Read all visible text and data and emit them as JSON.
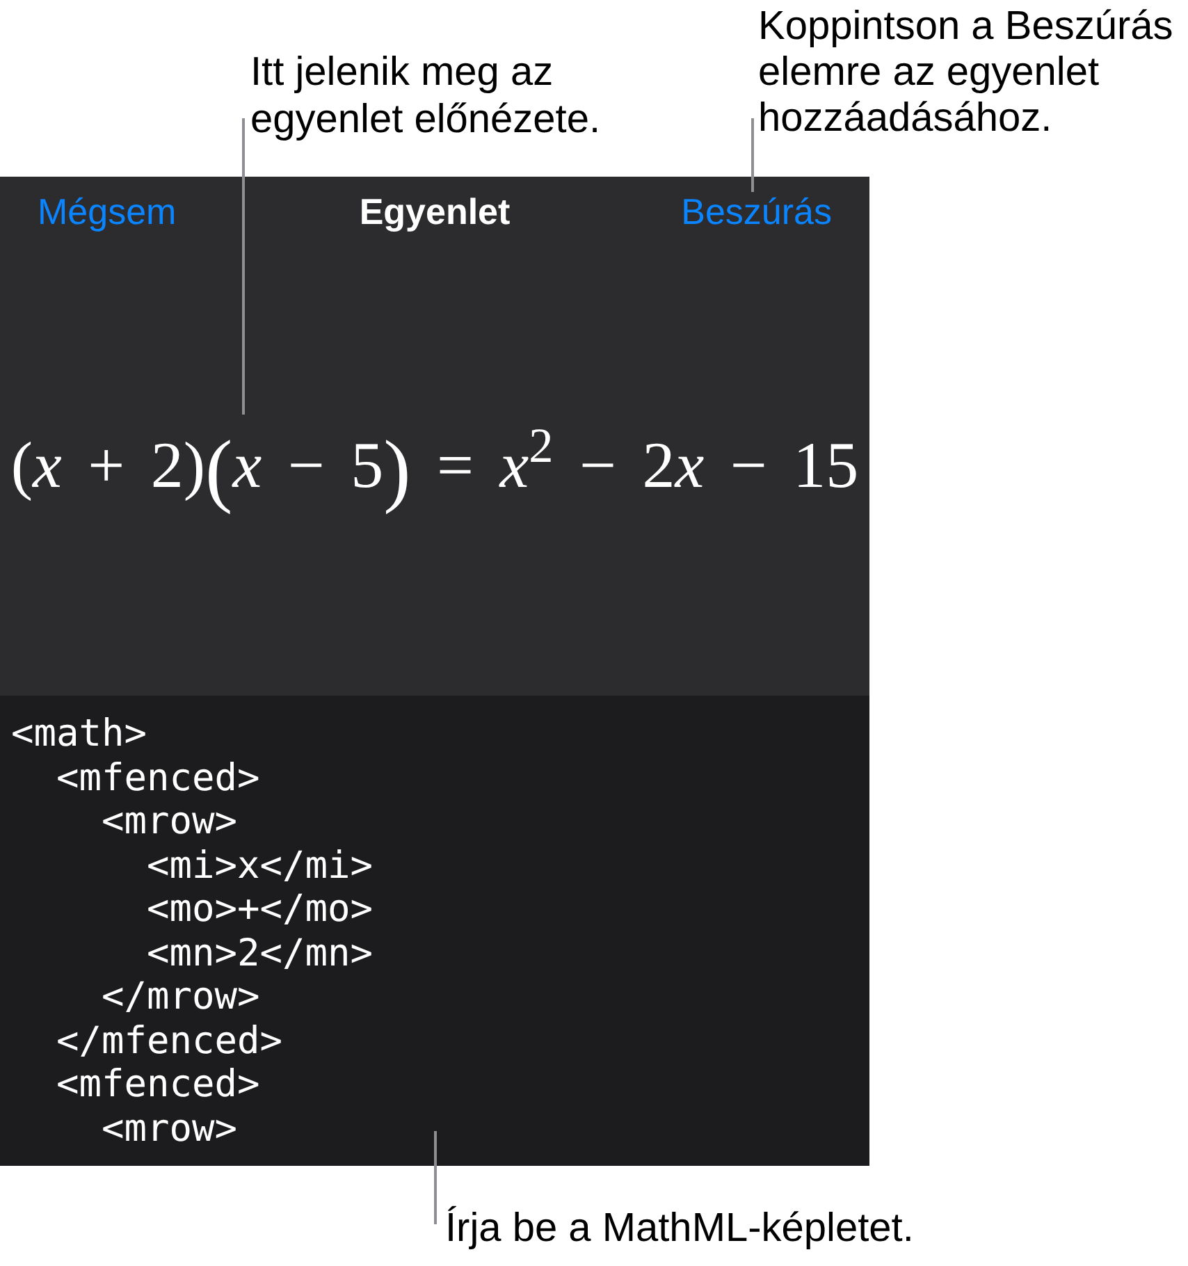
{
  "callouts": [
    {
      "text": "Itt jelenik meg az egyenlet előnézete."
    },
    {
      "text": "Koppintson a Beszúrás elemre az egyenlet hozzáadásához."
    },
    {
      "text": "Írja be a MathML-képletet."
    }
  ],
  "header": {
    "cancel": "Mégsem",
    "title": "Egyenlet",
    "insert": "Beszúrás"
  },
  "equation": {
    "segments": [
      {
        "kind": "math",
        "text": "(*x* + 2)"
      },
      {
        "kind": "fence",
        "text": "("
      },
      {
        "kind": "math",
        "text": "*x* − 5"
      },
      {
        "kind": "fence",
        "text": ")"
      },
      {
        "kind": "math",
        "text": " = *x*$^{2}$ − 2"
      },
      {
        "kind": "math",
        "text": "*x* − 15"
      }
    ]
  },
  "mathml_editor": {
    "lines": [
      {
        "text": "<math>",
        "children": [
          {
            "text": "<mfenced>",
            "children": [
              {
                "text": "<mrow>",
                "children": [
                  {
                    "text": "<mi>x</mi>"
                  },
                  {
                    "text": "<mo>+</mo>"
                  },
                  {
                    "text": "<mn>2</mn>"
                  }
                ]
              },
              {
                "text": "</mrow>"
              }
            ]
          },
          {
            "text": "</mfenced>"
          },
          {
            "text": "<mfenced>",
            "children": [
              {
                "text": "<mrow>"
              }
            ]
          }
        ]
      }
    ]
  }
}
